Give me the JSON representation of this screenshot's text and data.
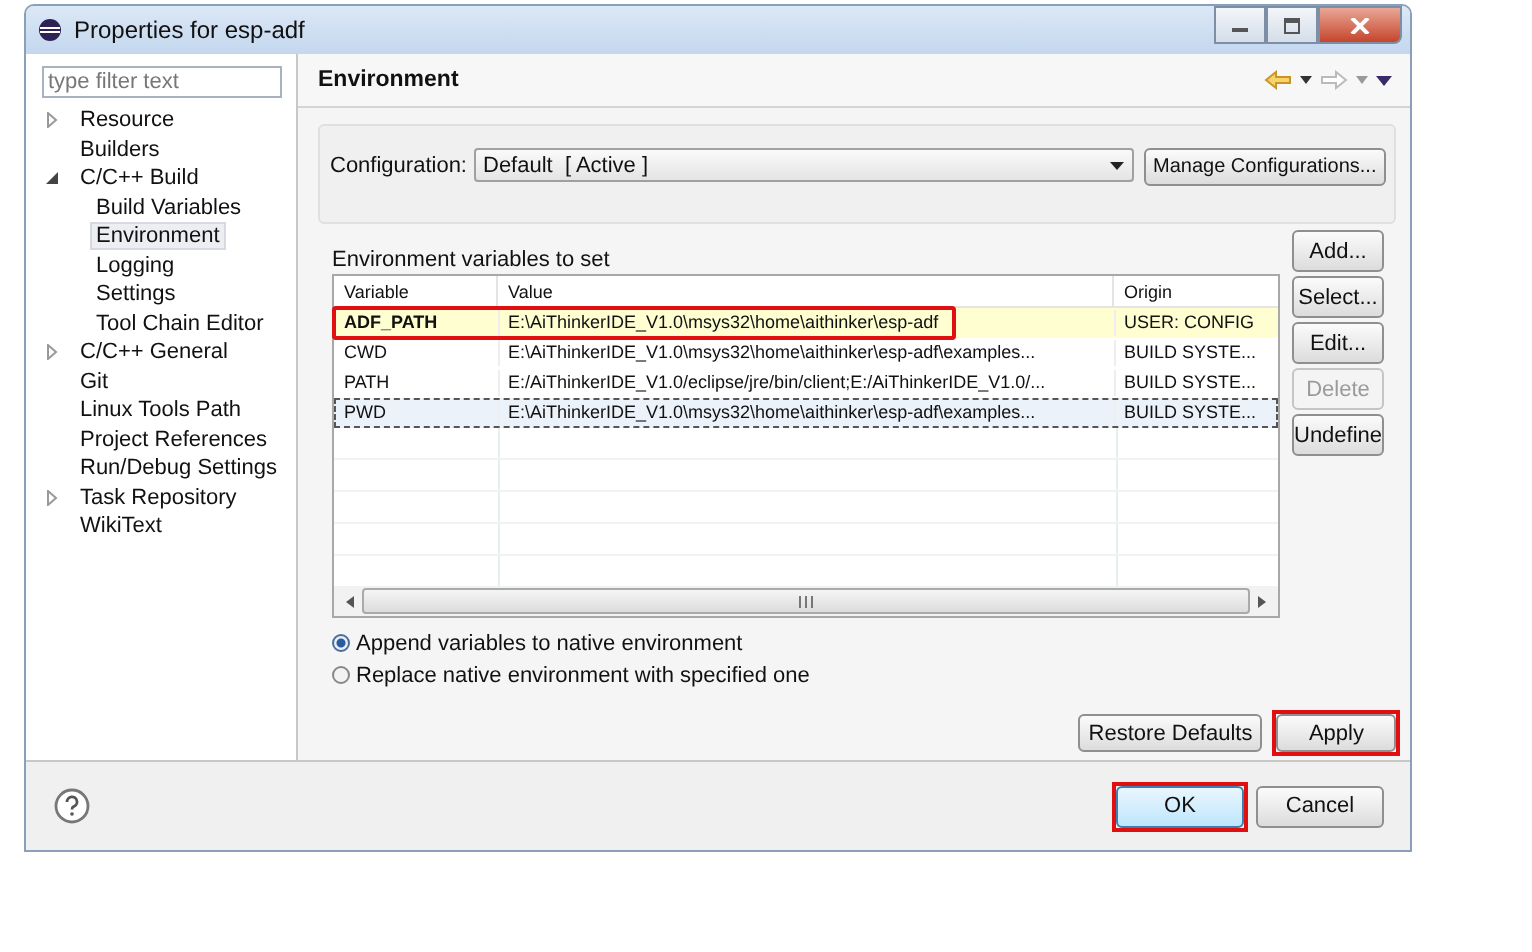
{
  "window": {
    "title": "Properties for esp-adf"
  },
  "filter": {
    "placeholder": "type filter text"
  },
  "tree": [
    {
      "label": "Resource",
      "expanded": false,
      "selected": false
    },
    {
      "label": "Builders",
      "selected": false
    },
    {
      "label": "C/C++ Build",
      "expanded": true,
      "selected": false,
      "children": [
        {
          "label": "Build Variables",
          "selected": false
        },
        {
          "label": "Environment",
          "selected": true
        },
        {
          "label": "Logging",
          "selected": false
        },
        {
          "label": "Settings",
          "selected": false
        },
        {
          "label": "Tool Chain Editor",
          "selected": false
        }
      ]
    },
    {
      "label": "C/C++ General",
      "expanded": false,
      "selected": false
    },
    {
      "label": "Git",
      "selected": false
    },
    {
      "label": "Linux Tools Path",
      "selected": false
    },
    {
      "label": "Project References",
      "selected": false
    },
    {
      "label": "Run/Debug Settings",
      "selected": false
    },
    {
      "label": "Task Repository",
      "expanded": false,
      "selected": false
    },
    {
      "label": "WikiText",
      "selected": false
    }
  ],
  "page": {
    "title": "Environment"
  },
  "configuration": {
    "label": "Configuration:",
    "value": "Default  [ Active ]",
    "manage_button": "Manage Configurations..."
  },
  "table": {
    "caption": "Environment variables to set",
    "columns": [
      "Variable",
      "Value",
      "Origin"
    ],
    "rows": [
      {
        "kind": "user",
        "variable": "ADF_PATH",
        "value": "E:\\AiThinkerIDE_V1.0\\msys32\\home\\aithinker\\esp-adf",
        "origin": "USER: CONFIG",
        "selected": false,
        "highlighted": true
      },
      {
        "kind": "build",
        "variable": "CWD",
        "value": "E:\\AiThinkerIDE_V1.0\\msys32\\home\\aithinker\\esp-adf\\examples...",
        "origin": "BUILD SYSTE...",
        "selected": false,
        "highlighted": false
      },
      {
        "kind": "build",
        "variable": "PATH",
        "value": "E:/AiThinkerIDE_V1.0/eclipse/jre/bin/client;E:/AiThinkerIDE_V1.0/...",
        "origin": "BUILD SYSTE...",
        "selected": false,
        "highlighted": false
      },
      {
        "kind": "build",
        "variable": "PWD",
        "value": "E:\\AiThinkerIDE_V1.0\\msys32\\home\\aithinker\\esp-adf\\examples...",
        "origin": "BUILD SYSTE...",
        "selected": true,
        "highlighted": false
      }
    ]
  },
  "side_buttons": [
    {
      "label": "Add...",
      "disabled": false
    },
    {
      "label": "Select...",
      "disabled": false
    },
    {
      "label": "Edit...",
      "disabled": false
    },
    {
      "label": "Delete",
      "disabled": true
    },
    {
      "label": "Undefine",
      "disabled": false
    }
  ],
  "options": [
    {
      "label": "Append variables to native environment",
      "selected": true
    },
    {
      "label": "Replace native environment with specified one",
      "selected": false
    }
  ],
  "page_buttons": [
    {
      "label": "Restore Defaults",
      "highlighted": false
    },
    {
      "label": "Apply",
      "highlighted": true
    }
  ],
  "dialog_buttons": [
    {
      "label": "OK",
      "default": true,
      "highlighted": true
    },
    {
      "label": "Cancel",
      "default": false,
      "highlighted": false
    }
  ]
}
